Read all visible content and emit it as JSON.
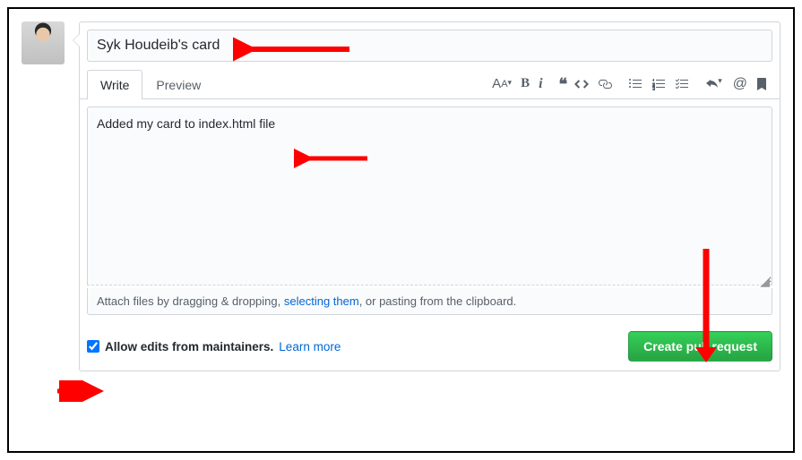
{
  "title_value": "Syk Houdeib's card",
  "tabs": {
    "write": "Write",
    "preview": "Preview"
  },
  "body_value": "Added my card to index.html file",
  "attach": {
    "prefix": "Attach files by dragging & dropping, ",
    "link": "selecting them",
    "suffix": ", or pasting from the clipboard."
  },
  "footer": {
    "allow_label": "Allow edits from maintainers.",
    "learn_more": "Learn more",
    "submit": "Create pull request"
  },
  "icons": {
    "heading": "AA",
    "bold": "B",
    "italic": "i",
    "quote": "❝",
    "at": "@"
  },
  "colors": {
    "link": "#0366d6",
    "border": "#d1d5da",
    "submit_bg": "#2ea44f",
    "arrow": "#ff0000"
  }
}
